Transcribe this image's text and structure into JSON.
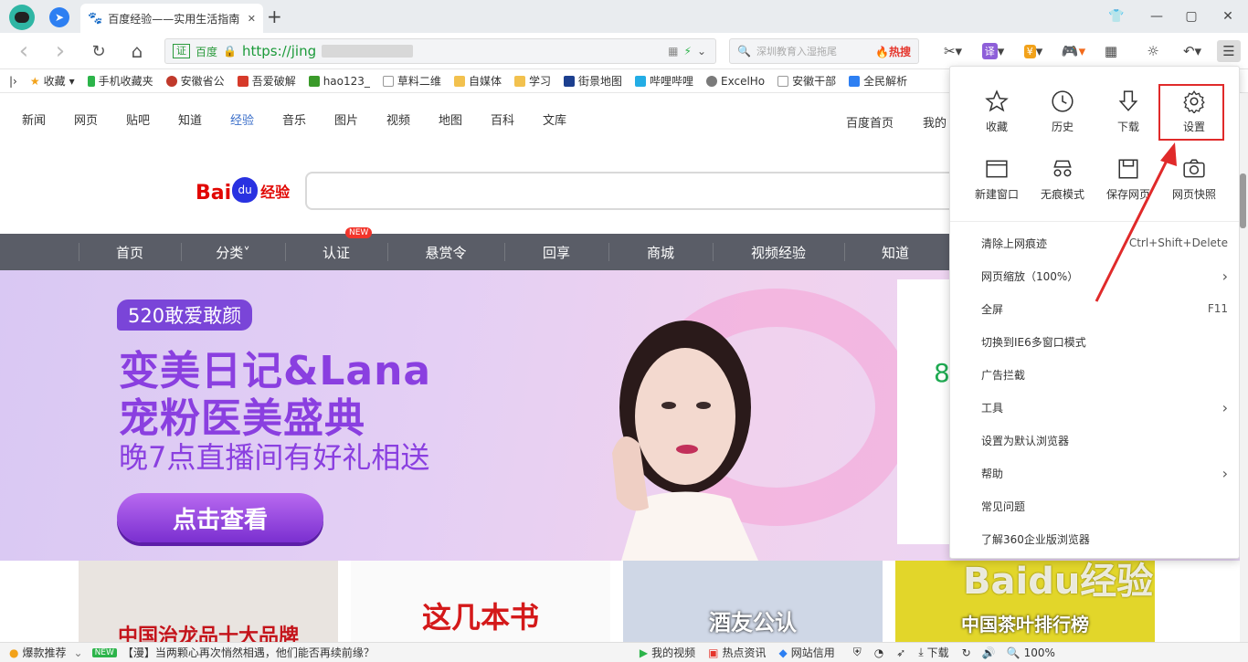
{
  "tab": {
    "title": "百度经验——实用生活指南",
    "new_tab": "+"
  },
  "window": {
    "min": "—",
    "max": "▢",
    "close": "✕",
    "skin": "👕"
  },
  "nav": {
    "back": "‹",
    "forward": "›",
    "refresh": "↻",
    "home": "⌂"
  },
  "address": {
    "cert": "证",
    "site": "百度",
    "url": "https://jing"
  },
  "search": {
    "placeholder": "深圳教育入湿拖尾",
    "hot": "🔥热搜"
  },
  "bookmarks": [
    "收藏",
    "手机收藏夹",
    "安徽省公",
    "吾爱破解",
    "hao123_",
    "草料二维",
    "自媒体",
    "学习",
    "街景地图",
    "哔哩哔哩",
    "ExcelHo",
    "安徽干部",
    "全民解析"
  ],
  "topnav": {
    "items": [
      "新闻",
      "网页",
      "贴吧",
      "知道",
      "经验",
      "音乐",
      "图片",
      "视频",
      "地图",
      "百科",
      "文库"
    ],
    "right": [
      "百度首页",
      "我的"
    ]
  },
  "logo": {
    "brand": "Bai",
    "paw": "du",
    "sub": "经验"
  },
  "categories": [
    "首页",
    "分类˅",
    "认证",
    "悬赏令",
    "回享",
    "商城",
    "视频经验",
    "知道"
  ],
  "new_badge": "NEW",
  "banner": {
    "tag": "520敢爱敢颜",
    "line1": "变美日记&Lana",
    "line2": "宠粉医美盛典",
    "line3": "晚7点直播间有好礼相送",
    "button": "点击查看",
    "side_num": "8"
  },
  "tiles": [
    "中国治龙品十大品牌",
    "这几本书",
    "酒友公认",
    "中国茶叶排行榜"
  ],
  "menu": {
    "icons": [
      {
        "label": "收藏",
        "icon": "star-icon"
      },
      {
        "label": "历史",
        "icon": "clock-icon"
      },
      {
        "label": "下载",
        "icon": "download-icon"
      },
      {
        "label": "设置",
        "icon": "gear-icon"
      },
      {
        "label": "新建窗口",
        "icon": "window-icon"
      },
      {
        "label": "无痕模式",
        "icon": "incognito-icon"
      },
      {
        "label": "保存网页",
        "icon": "save-icon"
      },
      {
        "label": "网页快照",
        "icon": "camera-icon"
      }
    ],
    "rows": [
      {
        "label": "清除上网痕迹",
        "right": "Ctrl+Shift+Delete"
      },
      {
        "label": "网页缩放（100%）",
        "right": "›"
      },
      {
        "label": "全屏",
        "right": "F11"
      },
      {
        "label": "切换到IE6多窗口模式",
        "right": ""
      },
      {
        "label": "广告拦截",
        "right": ""
      },
      {
        "label": "工具",
        "right": "›"
      },
      {
        "label": "设置为默认浏览器",
        "right": ""
      },
      {
        "label": "帮助",
        "right": "›"
      },
      {
        "label": "常见问题",
        "right": ""
      },
      {
        "label": "了解360企业版浏览器",
        "right": ""
      }
    ]
  },
  "status": {
    "left": "爆款推荐",
    "new": "NEW",
    "news": "【漫】当两颗心再次悄然相遇，他们能否再续前缘？",
    "items": [
      "我的视频",
      "热点资讯",
      "网站信用",
      "下载"
    ],
    "zoom": "100%"
  },
  "watermark": "Baidu经验"
}
